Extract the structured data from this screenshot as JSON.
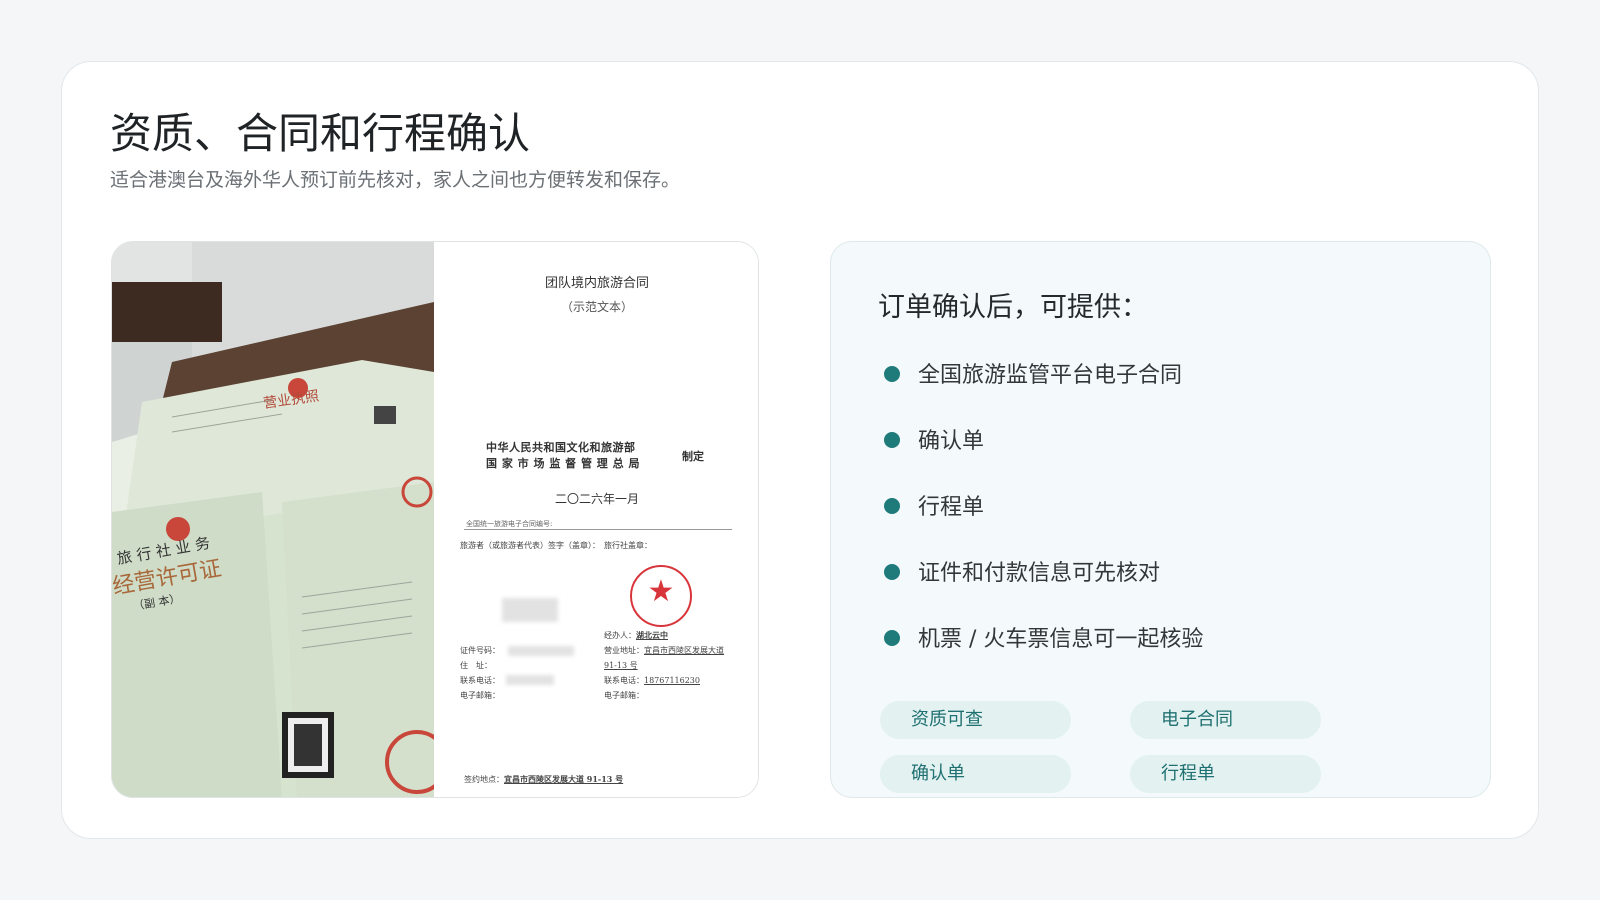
{
  "page": {
    "title": "资质、合同和行程确认",
    "subtitle": "适合港澳台及海外华人预订前先核对，家人之间也方便转发和保存。"
  },
  "photo": {
    "doc_title": "团队境内旅游合同",
    "doc_subtitle": "（示范文本）",
    "issuer_line1": "中华人民共和国文化和旅游部",
    "issuer_line2": "国 家 市 场 监 督 管 理 总 局",
    "issuer_suffix": "制定",
    "doc_date": "二〇二六年一月",
    "contract_code_label": "全国统一旅游电子合同编号:",
    "traveler_sign_label": "旅游者（或旅游者代表）签字（盖章）：",
    "agency_seal_label": "旅行社盖章：",
    "agent_label": "经办人：",
    "agent_value": "湖北云中",
    "address_label": "营业地址：",
    "address_value": "宜昌市西陵区发展大道 91-13 号",
    "id_label": "证件号码：",
    "home_label": "住　址：",
    "phone_label": "联系电话：",
    "phone_value": "18767116230",
    "email_label": "电子邮箱：",
    "sign_place_label": "签约地点：",
    "sign_place_value": "宜昌市西陵区发展大道 91-13 号",
    "license_title": "营业执照",
    "permit_line1": "旅 行 社 业 务",
    "permit_line2": "经营许可证",
    "permit_copy": "（副 本）"
  },
  "info": {
    "heading": "订单确认后，可提供：",
    "features": [
      "全国旅游监管平台电子合同",
      "确认单",
      "行程单",
      "证件和付款信息可先核对",
      "机票 / 火车票信息可一起核验"
    ],
    "tags": [
      "资质可查",
      "电子合同",
      "确认单",
      "行程单"
    ]
  },
  "colors": {
    "accent": "#1f7a7a",
    "tag_bg": "#e3f1f1",
    "stamp_red": "#d8353a"
  }
}
